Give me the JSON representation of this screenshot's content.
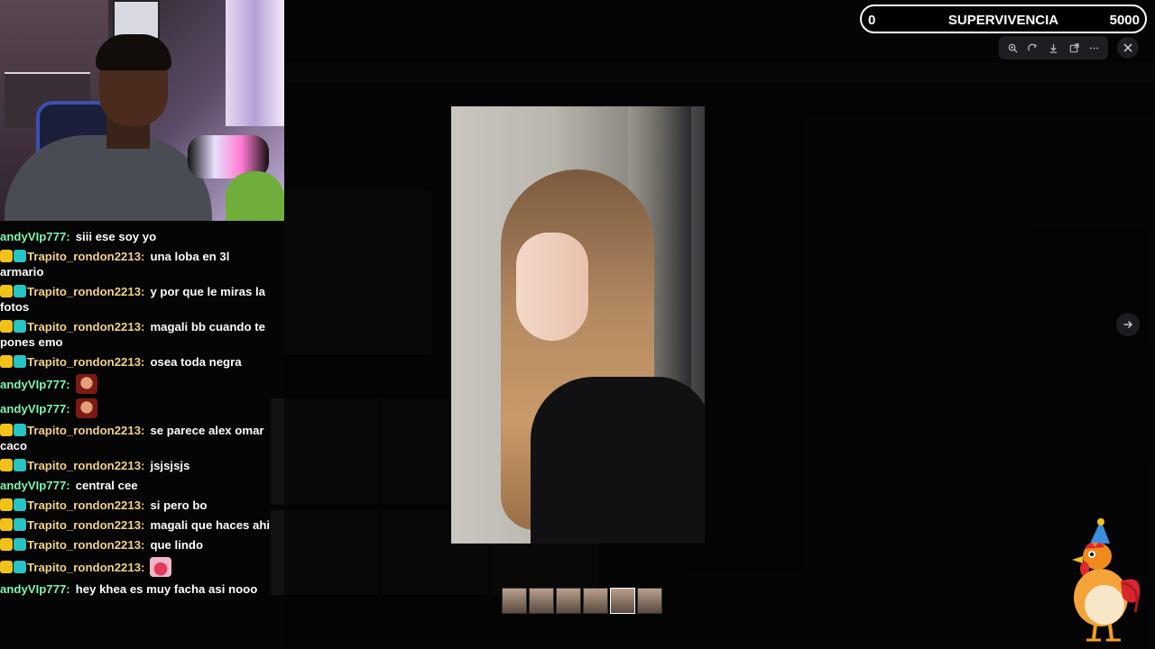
{
  "score_widget": {
    "min": "0",
    "title": "SUPERVIVENCIA",
    "max": "5000"
  },
  "toolbar": {
    "icons": [
      "zoom-in-icon",
      "rotate-icon",
      "download-icon",
      "open-external-icon",
      "more-icon"
    ],
    "close_icon": "close-icon",
    "next_icon": "arrow-right-icon"
  },
  "chat": {
    "messages": [
      {
        "user": "andyVIp777:",
        "text": "siii ese soy yo"
      },
      {
        "user": "Trapito_rondon2213:",
        "text": "una loba en 3l armario"
      },
      {
        "user": "Trapito_rondon2213:",
        "text": "y por que le miras la fotos"
      },
      {
        "user": "Trapito_rondon2213:",
        "text": "magali bb cuando te pones emo"
      },
      {
        "user": "Trapito_rondon2213:",
        "text": "osea toda negra"
      },
      {
        "user": "andyVIp777:",
        "text": ""
      },
      {
        "user": "andyVIp777:",
        "text": ""
      },
      {
        "user": "Trapito_rondon2213:",
        "text": "se parece alex omar caco"
      },
      {
        "user": "Trapito_rondon2213:",
        "text": "jsjsjsjs"
      },
      {
        "user": "andyVIp777:",
        "text": "central cee"
      },
      {
        "user": "Trapito_rondon2213:",
        "text": "si pero bo"
      },
      {
        "user": "Trapito_rondon2213:",
        "text": "magali que haces ahi"
      },
      {
        "user": "Trapito_rondon2213:",
        "text": "que lindo"
      },
      {
        "user": "Trapito_rondon2213:",
        "text": ""
      },
      {
        "user": "andyVIp777:",
        "text": "hey khea es muy facha asi nooo"
      }
    ]
  },
  "colors": {
    "user_green": "#7df9b4",
    "user_gold": "#f5d487",
    "badge_crown": "#f2c21b",
    "badge_gift": "#27c4c4"
  },
  "thumbnails": {
    "count": 6,
    "active_index": 4
  }
}
